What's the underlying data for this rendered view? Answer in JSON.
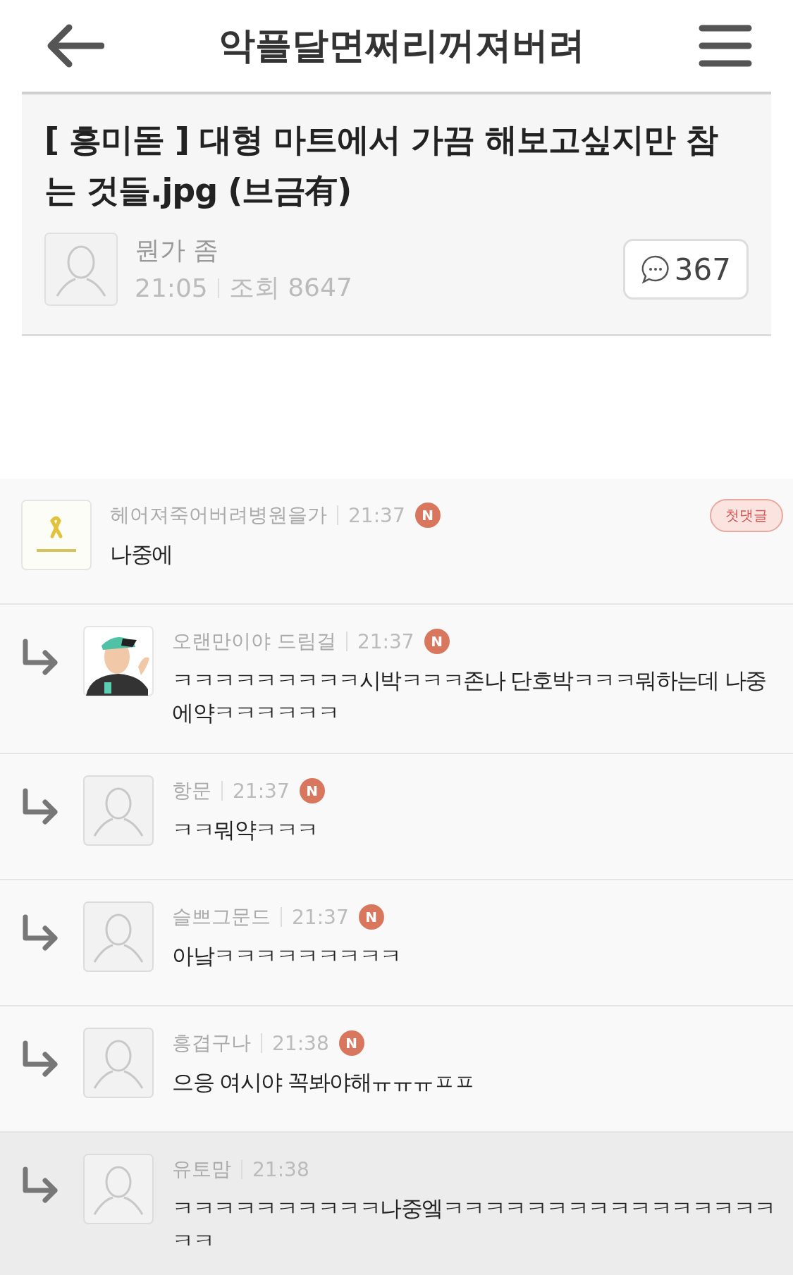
{
  "header": {
    "title": "악플달면쩌리꺼져버려"
  },
  "post": {
    "title": "[ 흥미돋 ] 대형 마트에서 가끔 해보고싶지만 참는 것들.jpg (브금有)",
    "author": "뭔가 좀",
    "time": "21:05",
    "views": "조회 8647",
    "comment_count": "367"
  },
  "comments": [
    {
      "kind": "top",
      "avatar": {
        "kind": "ribbon"
      },
      "name": "헤어져죽어버려병원을가",
      "time": "21:37",
      "is_new": true,
      "new_label": "N",
      "badge": "첫댓글",
      "body": "나중에",
      "highlighted": false
    },
    {
      "kind": "reply",
      "avatar": {
        "kind": "figure"
      },
      "name": "오랜만이야 드림걸",
      "time": "21:37",
      "is_new": true,
      "new_label": "N",
      "body": "ㅋㅋㅋㅋㅋㅋㅋㅋㅋ시박ㅋㅋㅋ존나  단호박ㅋㅋㅋ뭐하는데 나중에약ㅋㅋㅋㅋㅋㅋ",
      "highlighted": false
    },
    {
      "kind": "reply",
      "avatar": {
        "kind": "default"
      },
      "name": "항문",
      "time": "21:37",
      "is_new": true,
      "new_label": "N",
      "body": "ㅋㅋ뭐약ㅋㅋㅋ",
      "highlighted": false
    },
    {
      "kind": "reply",
      "avatar": {
        "kind": "default"
      },
      "name": "슬쁘그문드",
      "time": "21:37",
      "is_new": true,
      "new_label": "N",
      "body": "아낰ㅋㅋㅋㅋㅋㅋㅋㅋㅋ",
      "highlighted": false
    },
    {
      "kind": "reply",
      "avatar": {
        "kind": "default"
      },
      "name": "흥겹구나",
      "time": "21:38",
      "is_new": true,
      "new_label": "N",
      "body": "으응 여시야 꼭봐야해ㅠㅠㅠㅍㅍ",
      "highlighted": false
    },
    {
      "kind": "reply",
      "avatar": {
        "kind": "default"
      },
      "name": "유토맘",
      "time": "21:38",
      "is_new": false,
      "body": "ㅋㅋㅋㅋㅋㅋㅋㅋㅋㅋ나중엨ㅋㅋㅋㅋㅋㅋㅋㅋㅋㅋㅋㅋㅋㅋㅋㅋㅋㅋ",
      "highlighted": true
    }
  ]
}
